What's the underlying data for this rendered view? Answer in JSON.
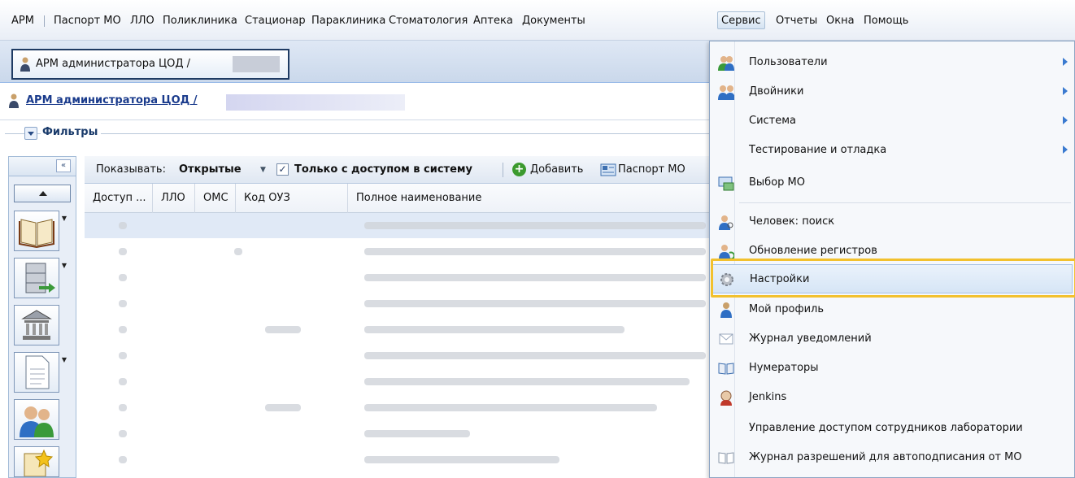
{
  "menubar": {
    "items": [
      "АРМ",
      "Паспорт МО",
      "ЛЛО",
      "Поликлиника",
      "Стационар",
      "Параклиника",
      "Стоматология",
      "Аптека",
      "Документы",
      "Сервис",
      "Отчеты",
      "Окна",
      "Помощь"
    ],
    "active": "Сервис"
  },
  "tab": {
    "label": "АРМ администратора ЦОД /"
  },
  "page": {
    "title": "АРМ администратора ЦОД /"
  },
  "filters": {
    "label": "Фильтры"
  },
  "toolbar": {
    "show_label": "Показывать:",
    "show_value": "Открытые",
    "access_checkbox_label": "Только с доступом в систему",
    "access_checked": true,
    "add_label": "Добавить",
    "passport_label": "Паспорт МО"
  },
  "grid": {
    "columns": [
      "Доступ ...",
      "ЛЛО",
      "ОМС",
      "Код ОУЗ",
      "Полное наименование"
    ]
  },
  "service_menu": {
    "items": [
      {
        "label": "Пользователи",
        "icon": "users-icon",
        "submenu": true
      },
      {
        "label": "Двойники",
        "icon": "twins-icon",
        "submenu": true
      },
      {
        "label": "Система",
        "icon": "",
        "submenu": true
      },
      {
        "label": "Тестирование и отладка",
        "icon": "",
        "submenu": true
      },
      {
        "label": "Выбор МО",
        "icon": "select-mo-icon",
        "submenu": false
      },
      {
        "label": "Человек: поиск",
        "icon": "person-search-icon",
        "submenu": false
      },
      {
        "label": "Обновление регистров",
        "icon": "registers-update-icon",
        "submenu": false
      },
      {
        "label": "Настройки",
        "icon": "gear-icon",
        "submenu": false,
        "highlighted": true
      },
      {
        "label": "Мой профиль",
        "icon": "profile-icon",
        "submenu": false
      },
      {
        "label": "Журнал уведомлений",
        "icon": "envelope-icon",
        "submenu": false
      },
      {
        "label": "Нумераторы",
        "icon": "book-icon",
        "submenu": false
      },
      {
        "label": "Jenkins",
        "icon": "jenkins-icon",
        "submenu": false
      },
      {
        "label": "Управление доступом сотрудников лаборатории",
        "icon": "",
        "submenu": false
      },
      {
        "label": "Журнал разрешений для автоподписания от МО",
        "icon": "journal-icon",
        "submenu": false
      }
    ]
  },
  "colors": {
    "highlight_box": "#f2c12e",
    "link": "#1a3b8c"
  }
}
